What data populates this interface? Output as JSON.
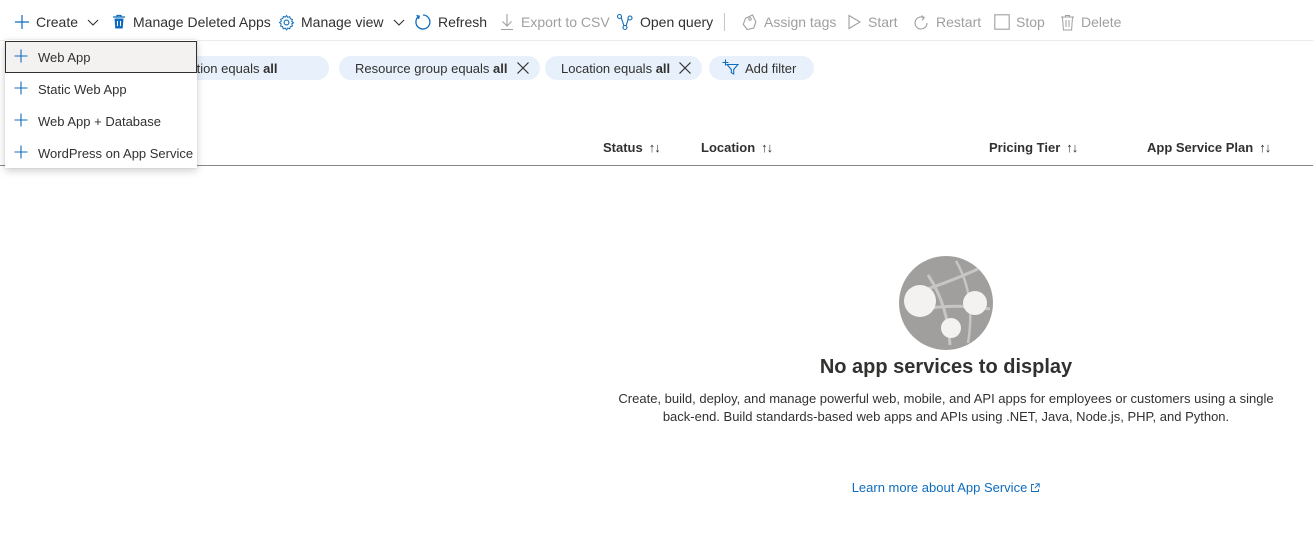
{
  "toolbar": {
    "create": "Create",
    "manage_deleted": "Manage Deleted Apps",
    "manage_view": "Manage view",
    "refresh": "Refresh",
    "export_csv": "Export to CSV",
    "open_query": "Open query",
    "assign_tags": "Assign tags",
    "start": "Start",
    "restart": "Restart",
    "stop": "Stop",
    "delete": "Delete"
  },
  "create_menu": {
    "items": [
      {
        "label": "Web App"
      },
      {
        "label": "Static Web App"
      },
      {
        "label": "Web App + Database"
      },
      {
        "label": "WordPress on App Service"
      }
    ]
  },
  "filters": {
    "subscription": {
      "text": "Subscription equals ",
      "value": "all"
    },
    "resource_group": {
      "text": "Resource group equals ",
      "value": "all"
    },
    "location": {
      "text": "Location equals ",
      "value": "all"
    },
    "add_filter": "Add filter"
  },
  "table": {
    "columns": [
      {
        "label": "Status"
      },
      {
        "label": "Location"
      },
      {
        "label": "Pricing Tier"
      },
      {
        "label": "App Service Plan"
      }
    ]
  },
  "empty_state": {
    "title": "No app services to display",
    "description": "Create, build, deploy, and manage powerful web, mobile, and API apps for employees or customers using a single back-end. Build standards-based web apps and APIs using .NET, Java, Node.js, PHP, and Python.",
    "link": "Learn more about App Service"
  },
  "colors": {
    "accent": "#0f6cbd",
    "pill_bg": "#e8f1fb",
    "disabled_text": "#a19f9d"
  },
  "icons": {
    "create": "plus-icon",
    "manage_deleted": "trash-icon",
    "manage_view": "gear-icon",
    "refresh": "refresh-icon",
    "export_csv": "download-icon",
    "open_query": "query-icon",
    "assign_tags": "tag-icon",
    "start": "play-icon",
    "restart": "restart-icon",
    "stop": "stop-icon",
    "delete": "delete-icon"
  }
}
